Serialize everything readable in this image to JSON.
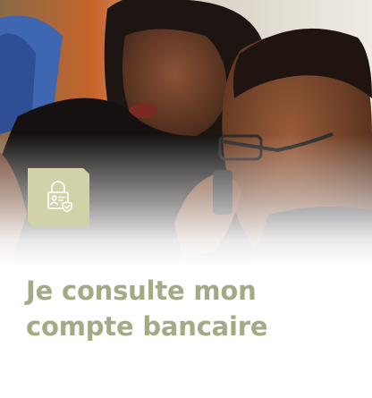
{
  "card": {
    "title_line1": "Je consulte mon",
    "title_line2": "compte bancaire",
    "icon": "lock-account-icon",
    "photo": "two-people-looking-at-screen-photo"
  },
  "colors": {
    "title": "#a4aa85",
    "icon_badge": "#d2d2a9",
    "icon_stroke": "#ffffff"
  }
}
